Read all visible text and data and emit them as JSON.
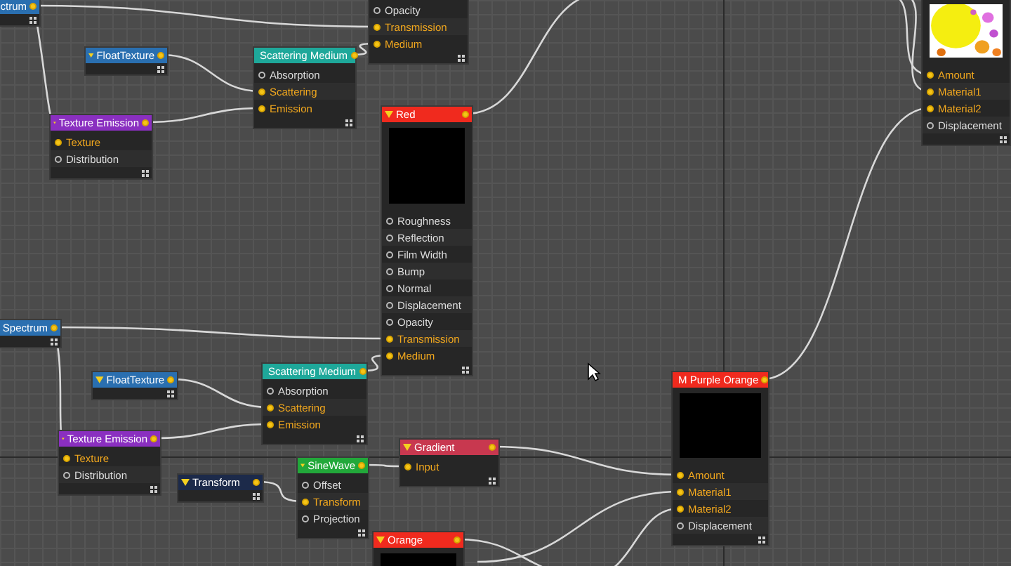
{
  "nodes": [
    {
      "title": "ctrum",
      "color": "#2a6fb0"
    },
    {
      "ports": [
        {
          "label": "Opacity",
          "connected": false
        },
        {
          "label": "Transmission",
          "connected": true
        },
        {
          "label": "Medium",
          "connected": true
        }
      ]
    },
    {
      "title": "FloatTexture",
      "color": "#2a6fb0"
    },
    {
      "title": "Scattering Medium",
      "color": "#1ea89a",
      "ports": [
        {
          "label": "Absorption",
          "connected": false
        },
        {
          "label": "Scattering",
          "connected": true
        },
        {
          "label": "Emission",
          "connected": true
        }
      ]
    },
    {
      "title": "Texture Emission",
      "color": "#8a2fc0",
      "ports": [
        {
          "label": "Texture",
          "connected": true
        },
        {
          "label": "Distribution",
          "connected": false
        }
      ]
    },
    {
      "title": "Red",
      "color": "#f02a1e",
      "preview": true,
      "ports": [
        {
          "label": "Roughness",
          "connected": false
        },
        {
          "label": "Reflection",
          "connected": false
        },
        {
          "label": "Film Width",
          "connected": false
        },
        {
          "label": "Bump",
          "connected": false
        },
        {
          "label": "Normal",
          "connected": false
        },
        {
          "label": "Displacement",
          "connected": false
        },
        {
          "label": "Opacity",
          "connected": false
        },
        {
          "label": "Transmission",
          "connected": true
        },
        {
          "label": "Medium",
          "connected": true
        }
      ]
    },
    {
      "kind": "picture",
      "ports": [
        {
          "label": "Amount",
          "connected": true
        },
        {
          "label": "Material1",
          "connected": true
        },
        {
          "label": "Material2",
          "connected": true
        },
        {
          "label": "Displacement",
          "connected": false
        }
      ]
    },
    {
      "title": "Spectrum",
      "color": "#2a6fb0"
    },
    {
      "title": "FloatTexture",
      "color": "#2a6fb0"
    },
    {
      "title": "Scattering Medium",
      "color": "#1ea89a",
      "ports": [
        {
          "label": "Absorption",
          "connected": false
        },
        {
          "label": "Scattering",
          "connected": true
        },
        {
          "label": "Emission",
          "connected": true
        }
      ]
    },
    {
      "title": "Texture Emission",
      "color": "#8a2fc0",
      "ports": [
        {
          "label": "Texture",
          "connected": true
        },
        {
          "label": "Distribution",
          "connected": false
        }
      ]
    },
    {
      "title": "Gradient",
      "color": "#c8384f",
      "ports": [
        {
          "label": "Input",
          "connected": true
        }
      ]
    },
    {
      "title": "SineWave",
      "color": "#22a83a",
      "ports": [
        {
          "label": "Offset",
          "connected": false
        },
        {
          "label": "Transform",
          "connected": true
        },
        {
          "label": "Projection",
          "connected": false
        }
      ]
    },
    {
      "title": "Transform",
      "color": "#1c2a4a"
    },
    {
      "title": "M Purple Orange",
      "color": "#f02a1e",
      "preview": true,
      "ports": [
        {
          "label": "Amount",
          "connected": true
        },
        {
          "label": "Material1",
          "connected": true
        },
        {
          "label": "Material2",
          "connected": true
        },
        {
          "label": "Displacement",
          "connected": false
        }
      ]
    },
    {
      "title": "Orange",
      "color": "#f02a1e",
      "preview": true
    }
  ]
}
